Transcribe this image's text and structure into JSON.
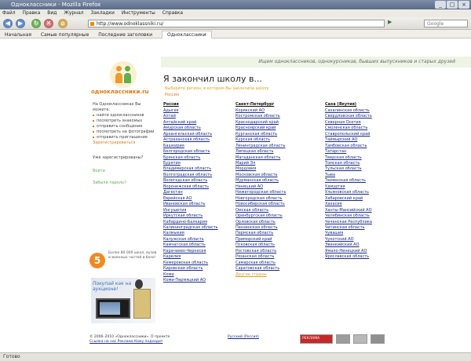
{
  "browser": {
    "title": "Одноклассники - Mozilla Firefox",
    "menu": [
      "Файл",
      "Правка",
      "Вид",
      "Журнал",
      "Закладки",
      "Инструменты",
      "Справка"
    ],
    "url": "http://www.odnoklassniki.ru/",
    "search_placeholder": "Google",
    "bookmarks": [
      "Начальная",
      "Самые популярные",
      "Последние заголовки"
    ],
    "tab_label": "Одноклассники",
    "status": "Готово"
  },
  "site": {
    "logo_text": "одноклассники.ru",
    "tagline": "Ищем одноклассников, однокурсников, бывших выпускников и старых друзей",
    "heading": "Я закончил школу в...",
    "subline": "Выберите регион, в котором Вы закончили школу",
    "subline2": "Россия",
    "sidebar": {
      "intro": "На Одноклассниках Вы можете:",
      "items": [
        "найти одноклассников",
        "посмотреть знакомых",
        "отправить сообщение",
        "посмотреть на фотографии",
        "отправить приглашение"
      ],
      "register_link": "Зарегистрироваться",
      "already": "Уже зарегистрированы?",
      "login": "Войти",
      "forgot": "Забыли пароль?"
    },
    "promo": {
      "badge": "5",
      "text": "Более 80 000 школ, вузов и военных частей в базе!"
    },
    "ad": {
      "text": "Покупай как на аукционе!"
    },
    "columns": [
      {
        "header": "Россия",
        "items": [
          "Адыгея",
          "Алтай",
          "Алтайский край",
          "Амурская область",
          "Архангельская область",
          "Астраханская область",
          "Башкирия",
          "Белгородская область",
          "Брянская область",
          "Бурятия",
          "Владимирская область",
          "Волгоградская область",
          "Вологодская область",
          "Воронежская область",
          "Дагестан",
          "Еврейская АО",
          "Ивановская область",
          "Ингушетия",
          "Иркутская область",
          "Кабардино-Балкария",
          "Калининградская область",
          "Калмыкия",
          "Калужская область",
          "Камчатская область",
          "Карачаево-Черкесия",
          "Карелия",
          "Кемеровская область",
          "Кировская область",
          "Коми",
          "Коми-Пермяцкий АО"
        ]
      },
      {
        "header": "Санкт-Петербург",
        "items": [
          "Корякский АО",
          "Костромская область",
          "Краснодарский край",
          "Красноярский край",
          "Курганская область",
          "Курская область",
          "Ленинградская область",
          "Липецкая область",
          "Магаданская область",
          "Марий Эл",
          "Мордовия",
          "Московская область",
          "Мурманская область",
          "Ненецкий АО",
          "Нижегородская область",
          "Новгородская область",
          "Новосибирская область",
          "Омская область",
          "Оренбургская область",
          "Орловская область",
          "Пензенская область",
          "Пермская область",
          "Приморский край",
          "Псковская область",
          "Ростовская область",
          "Рязанская область",
          "Самарская область",
          "Саратовская область"
        ],
        "more": "Другие страны"
      },
      {
        "header": "Саха (Якутия)",
        "items": [
          "Сахалинская область",
          "Свердловская область",
          "Северная Осетия",
          "Смоленская область",
          "Ставропольский край",
          "Таймырский АО",
          "Тамбовская область",
          "Татарстан",
          "Тверская область",
          "Томская область",
          "Тульская область",
          "Тыва",
          "Тюменская область",
          "Удмуртия",
          "Ульяновская область",
          "Хабаровский край",
          "Хакасия",
          "Ханты-Мансийский АО",
          "Челябинская область",
          "Чеченская Республика",
          "Читинская область",
          "Чувашия",
          "Чукотский АО",
          "Эвенкийский АО",
          "Ямало-Ненецкий АО",
          "Ярославская область"
        ]
      }
    ],
    "footer": {
      "copyright": "© 2006–2010 «Одноклассники». О проекте",
      "links": "Ссылка на нас  Реклама  Кому подходит",
      "lang": "Русский (Россия)",
      "badges": [
        "РЕКЛАМА",
        "",
        "",
        ""
      ]
    }
  }
}
